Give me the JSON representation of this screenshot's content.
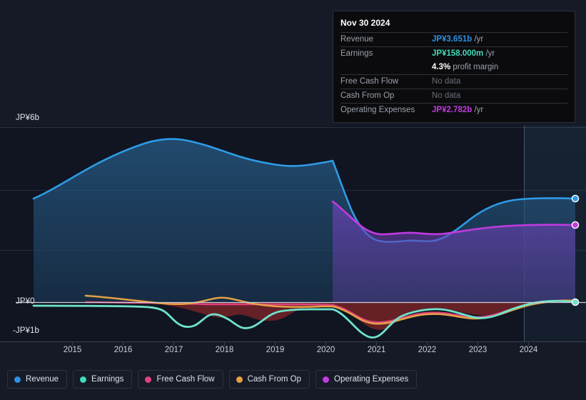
{
  "tooltip": {
    "date": "Nov 30 2024",
    "rows": [
      {
        "label": "Revenue",
        "value": "JP¥3.651b",
        "unit": "/yr",
        "style": "revenue"
      },
      {
        "label": "Earnings",
        "value": "JP¥158.000m",
        "unit": "/yr",
        "style": "earnings"
      },
      {
        "label": "",
        "value": "4.3%",
        "unit": "profit margin",
        "style": "margin"
      },
      {
        "label": "Free Cash Flow",
        "value": "No data",
        "unit": "",
        "style": "nodata"
      },
      {
        "label": "Cash From Op",
        "value": "No data",
        "unit": "",
        "style": "nodata"
      },
      {
        "label": "Operating Expenses",
        "value": "JP¥2.782b",
        "unit": "/yr",
        "style": "opex"
      }
    ]
  },
  "axes": {
    "y_top": "JP¥6b",
    "y_zero": "JP¥0",
    "y_neg": "-JP¥1b",
    "x_ticks": [
      "2015",
      "2016",
      "2017",
      "2018",
      "2019",
      "2020",
      "2021",
      "2022",
      "2023",
      "2024"
    ]
  },
  "legend": [
    {
      "label": "Revenue",
      "color": "#2e90e0"
    },
    {
      "label": "Earnings",
      "color": "#43d9b8"
    },
    {
      "label": "Free Cash Flow",
      "color": "#e0417c"
    },
    {
      "label": "Cash From Op",
      "color": "#e5a144"
    },
    {
      "label": "Operating Expenses",
      "color": "#c23ae0"
    }
  ],
  "chart_data": {
    "type": "area",
    "title": "",
    "xlabel": "",
    "ylabel": "JP¥",
    "ylim": [
      -1,
      6
    ],
    "yticks": [
      6,
      0,
      -1
    ],
    "ytick_labels": [
      "JP¥6b",
      "JP¥0",
      "-JP¥1b"
    ],
    "grid": true,
    "legend_position": "bottom",
    "x_range": [
      2014.6,
      2025.2
    ],
    "forecast_start": 2024.35,
    "x": [
      2014.75,
      2015.0,
      2015.5,
      2016.0,
      2016.4,
      2016.8,
      2017.2,
      2017.6,
      2018.0,
      2018.4,
      2018.8,
      2019.2,
      2019.6,
      2019.9,
      2020.05,
      2020.3,
      2020.6,
      2020.9,
      2021.2,
      2021.5,
      2021.9,
      2022.3,
      2022.7,
      2023.1,
      2023.5,
      2023.9,
      2024.3,
      2024.7,
      2025.0
    ],
    "series": [
      {
        "name": "Revenue",
        "color": "#2e90e0",
        "fill": "rgba(34,98,150,0.42)",
        "values": [
          3.5,
          3.75,
          4.45,
          5.2,
          5.55,
          5.68,
          5.62,
          5.45,
          5.26,
          5.16,
          5.14,
          5.05,
          5.16,
          5.22,
          5.22,
          3.9,
          3.1,
          2.58,
          2.52,
          2.58,
          2.5,
          2.58,
          2.82,
          3.1,
          3.35,
          3.5,
          3.58,
          3.62,
          3.651
        ],
        "end_marker": true
      },
      {
        "name": "Operating Expenses",
        "color": "#c23ae0",
        "fill": "rgba(96,60,160,0.45)",
        "start_x": 2020.0,
        "values": [
          null,
          null,
          null,
          null,
          null,
          null,
          null,
          null,
          null,
          null,
          null,
          null,
          null,
          null,
          3.38,
          3.0,
          2.72,
          2.55,
          2.55,
          2.58,
          2.55,
          2.6,
          2.66,
          2.7,
          2.72,
          2.74,
          2.76,
          2.78,
          2.782
        ],
        "end_marker": true
      },
      {
        "name": "Earnings",
        "color": "#43d9b8",
        "fill": "rgba(110,40,45,0.55)",
        "values": [
          0.03,
          0.03,
          0.03,
          0.03,
          0.03,
          0.01,
          -0.02,
          -0.05,
          -0.18,
          -0.3,
          -0.22,
          -0.38,
          -0.48,
          -0.36,
          -0.3,
          -0.12,
          -0.36,
          -0.58,
          -0.72,
          -0.5,
          -0.25,
          -0.1,
          -0.05,
          -0.18,
          -0.26,
          -0.2,
          -0.02,
          0.1,
          0.158
        ],
        "end_marker": true
      },
      {
        "name": "Cash From Op",
        "color": "#e5a144",
        "start_x": 2015.45,
        "values": [
          null,
          null,
          0.16,
          0.12,
          0.08,
          0.05,
          0.02,
          0.1,
          0.12,
          0.04,
          -0.02,
          -0.04,
          -0.05,
          -0.04,
          -0.04,
          -0.04,
          -0.18,
          -0.28,
          -0.3,
          -0.22,
          -0.1,
          -0.04,
          -0.02,
          -0.08,
          -0.12,
          -0.14,
          -0.02,
          0.1,
          0.14
        ],
        "end_marker": false
      },
      {
        "name": "Free Cash Flow",
        "color": "#e0417c",
        "start_x": 2015.45,
        "values": [
          null,
          null,
          0.02,
          0.0,
          -0.01,
          -0.02,
          -0.03,
          -0.02,
          -0.02,
          -0.03,
          -0.05,
          -0.06,
          -0.07,
          -0.06,
          -0.06,
          -0.07,
          -0.22,
          -0.32,
          -0.34,
          -0.26,
          -0.13,
          -0.06,
          -0.04,
          -0.1,
          -0.14,
          -0.16,
          -0.04,
          0.07,
          0.11
        ],
        "end_marker": false
      }
    ]
  }
}
